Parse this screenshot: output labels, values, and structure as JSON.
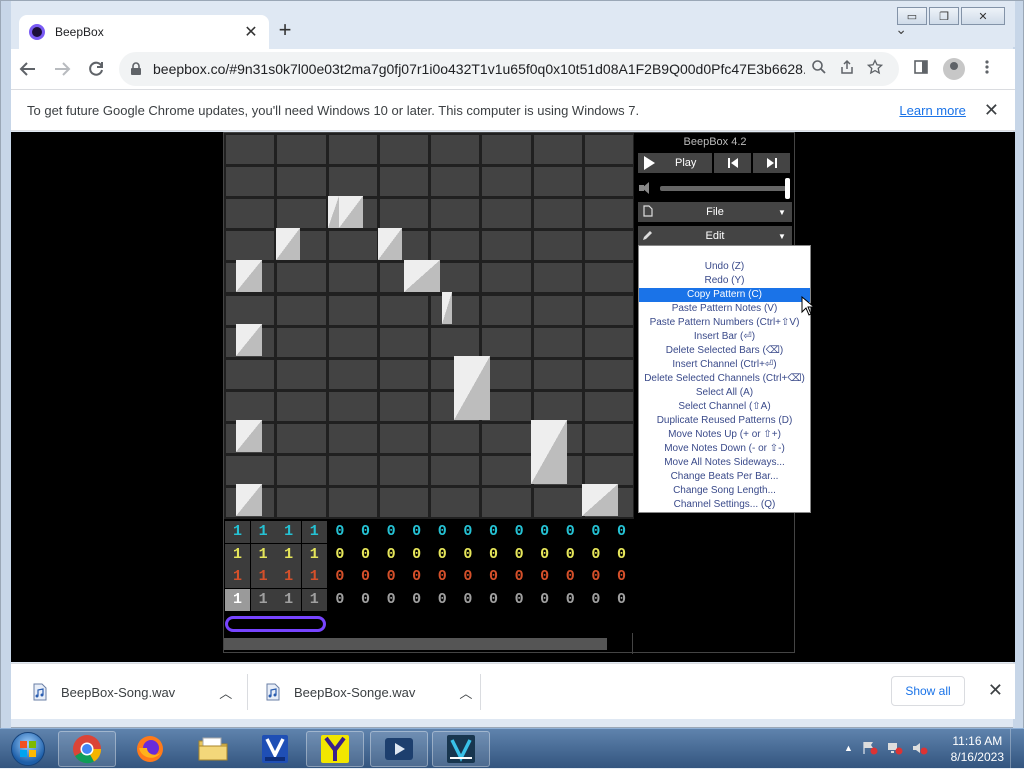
{
  "browser": {
    "tab_title": "BeepBox",
    "tab_close": "✕",
    "new_tab": "+",
    "tab_search": "⌄",
    "url": "beepbox.co/#9n31s0k7l00e03t2ma7g0fj07r1i0o432T1v1u65f0q0x10t51d08A1F2B9Q00d0Pfc47E3b6628...",
    "window_buttons": [
      "▭",
      "❐",
      "✕"
    ]
  },
  "infobar": {
    "message": "To get future Google Chrome updates, you'll need Windows 10 or later. This computer is using Windows 7.",
    "link": "Learn more",
    "close": "✕"
  },
  "beepbox": {
    "version": "BeepBox 4.2",
    "play_label": "Play",
    "file_label": "File",
    "edit_label": "Edit",
    "volume": 1.0,
    "menu_items": [
      "Undo (Z)",
      "Redo (Y)",
      "Copy Pattern (C)",
      "Paste Pattern Notes (V)",
      "Paste Pattern Numbers (Ctrl+⇧V)",
      "Insert Bar (⏎)",
      "Delete Selected Bars (⌫)",
      "Insert Channel (Ctrl+⏎)",
      "Delete Selected Channels (Ctrl+⌫)",
      "Select All (A)",
      "Select Channel (⇧A)",
      "Duplicate Reused Patterns (D)",
      "Move Notes Up (+ or ⇧+)",
      "Move Notes Down (- or ⇧-)",
      "Move All Notes Sideways...",
      "Change Beats Per Bar...",
      "Change Song Length...",
      "Channel Settings... (Q)"
    ],
    "highlighted_index": 2,
    "tracks": [
      {
        "color": "#25c2d4",
        "values": [
          "1",
          "1",
          "1",
          "1",
          "0",
          "0",
          "0",
          "0",
          "0",
          "0",
          "0",
          "0",
          "0",
          "0",
          "0",
          "0"
        ]
      },
      {
        "color": "#e6e65a",
        "values": [
          "1",
          "1",
          "1",
          "1",
          "0",
          "0",
          "0",
          "0",
          "0",
          "0",
          "0",
          "0",
          "0",
          "0",
          "0",
          "0"
        ]
      },
      {
        "color": "#d5502a",
        "values": [
          "1",
          "1",
          "1",
          "1",
          "0",
          "0",
          "0",
          "0",
          "0",
          "0",
          "0",
          "0",
          "0",
          "0",
          "0",
          "0"
        ]
      },
      {
        "color": "#a0a0a0",
        "values": [
          "1",
          "1",
          "1",
          "1",
          "0",
          "0",
          "0",
          "0",
          "0",
          "0",
          "0",
          "0",
          "0",
          "0",
          "0",
          "0"
        ]
      }
    ],
    "loop_bars": 4
  },
  "downloads": {
    "items": [
      "BeepBox-Song.wav",
      "BeepBox-Songe.wav"
    ],
    "show_all": "Show all",
    "close": "✕"
  },
  "taskbar": {
    "time": "11:16 AM",
    "date": "8/16/2023",
    "tray_up": "▲"
  }
}
